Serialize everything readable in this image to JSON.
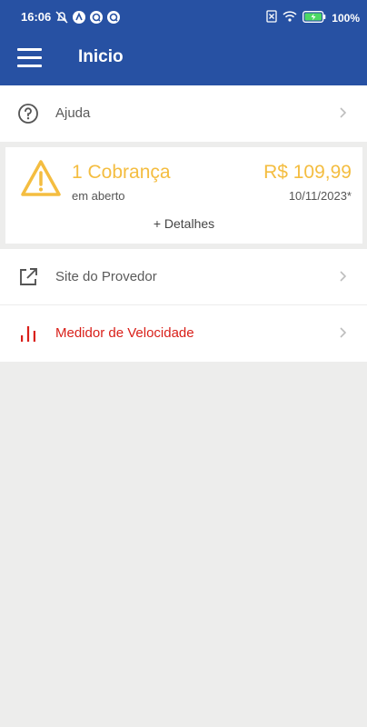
{
  "status_bar": {
    "time": "16:06",
    "battery": "100%",
    "icons_left": [
      "alarm-off-icon",
      "vpn-a-icon",
      "sync-icon",
      "sync-icon"
    ],
    "icons_right": [
      "sim-x-icon",
      "wifi-icon",
      "battery-charging-icon"
    ]
  },
  "header": {
    "title": "Inicio",
    "color": "#2751a3"
  },
  "menu": {
    "help": {
      "label": "Ajuda",
      "icon": "help-circle-icon"
    },
    "provider_site": {
      "label": "Site do Provedor",
      "icon": "external-link-icon"
    },
    "speed_meter": {
      "label": "Medidor de Velocidade",
      "icon": "bar-chart-icon",
      "color": "#d9201a"
    }
  },
  "billing_card": {
    "count_label": "1 Cobrança",
    "status": "em aberto",
    "amount": "R$ 109,99",
    "date": "10/11/2023*",
    "details_link": "+ Detalhes",
    "accent": "#f4bd40"
  }
}
